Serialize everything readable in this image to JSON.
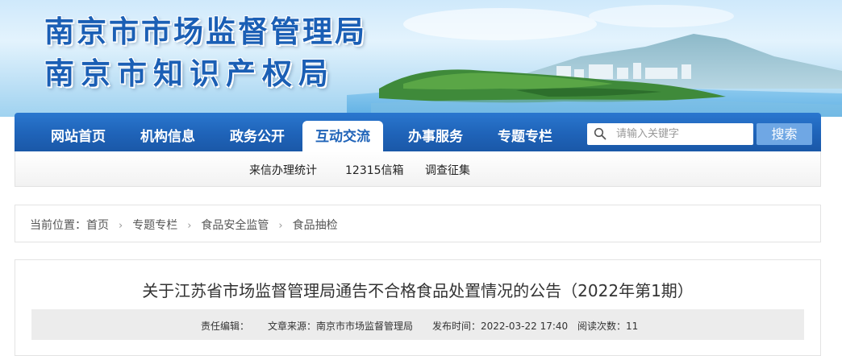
{
  "site": {
    "title_line1": "南京市市场监督管理局",
    "title_line2": "南京市知识产权局"
  },
  "nav": {
    "items": [
      {
        "label": "网站首页"
      },
      {
        "label": "机构信息"
      },
      {
        "label": "政务公开"
      },
      {
        "label": "互动交流",
        "active": true
      },
      {
        "label": "办事服务"
      },
      {
        "label": "专题专栏"
      }
    ],
    "search_placeholder": "请输入关键字",
    "search_button": "搜索",
    "colors": {
      "nav_blue": "#1f63b8",
      "search_button": "#6fa7e4"
    }
  },
  "subnav": {
    "items": [
      {
        "label": "来信办理统计"
      },
      {
        "label": "12315信箱"
      },
      {
        "label": "调查征集"
      }
    ]
  },
  "breadcrumb": {
    "prefix": "当前位置：",
    "items": [
      "首页",
      "专题专栏",
      "食品安全监管",
      "食品抽检"
    ],
    "separator": "›"
  },
  "article": {
    "title": "关于江苏省市场监督管理局通告不合格食品处置情况的公告（2022年第1期）",
    "meta": {
      "editor_label": "责任编辑：",
      "editor_value": "",
      "source_label": "文章来源：",
      "source_value": "南京市市场监督管理局",
      "time_label": "发布时间：",
      "time_value": "2022-03-22 17:40",
      "views_label": "阅读次数：",
      "views_value": "11"
    }
  },
  "icons": {
    "search": "search-icon",
    "breadcrumb_separator": "chevron-right-icon"
  }
}
